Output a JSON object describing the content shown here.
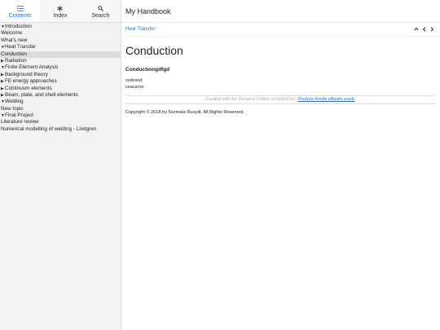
{
  "tabs": [
    {
      "label": "Contents",
      "icon": "list-icon"
    },
    {
      "label": "Index",
      "icon": "asterisk-icon"
    },
    {
      "label": "Search",
      "icon": "search-icon"
    }
  ],
  "toc": [
    {
      "label": "Introduction",
      "arrow": "open"
    },
    {
      "label": "Welcome",
      "arrow": ""
    },
    {
      "label": "What's new",
      "arrow": ""
    },
    {
      "label": "Heat Transfer",
      "arrow": "open"
    },
    {
      "label": "Conduction",
      "arrow": "",
      "selected": true
    },
    {
      "label": "Radiation",
      "arrow": "closed"
    },
    {
      "label": "Finite Element Analysis",
      "arrow": "open"
    },
    {
      "label": "Background theory",
      "arrow": "closed"
    },
    {
      "label": "FE energy approaches",
      "arrow": "closed"
    },
    {
      "label": "Continuum elements",
      "arrow": "closed"
    },
    {
      "label": "Beam, plate, and shell elements",
      "arrow": "closed"
    },
    {
      "label": "Welding",
      "arrow": "open"
    },
    {
      "label": "New topic",
      "arrow": ""
    },
    {
      "label": "Final Project",
      "arrow": "open"
    },
    {
      "label": "Literature review",
      "arrow": ""
    },
    {
      "label": "Numerical modelling of welding - Lindgren",
      "arrow": ""
    }
  ],
  "header": {
    "title": "My Handbook"
  },
  "breadcrumb": {
    "item": "Heat Transfer",
    "sep": "/"
  },
  "page": {
    "title": "Conduction",
    "heading": "Conductiongdfgd",
    "lines": [
      "vsdvsvd",
      "csacsvss"
    ],
    "credit_text": "Created with the Personal Edition of HelpNDoc:",
    "credit_link": "Produce Kindle eBooks easily",
    "copyright": "Copyright © 2018 by Nurmala Rusydi. All Rights Reserved."
  }
}
